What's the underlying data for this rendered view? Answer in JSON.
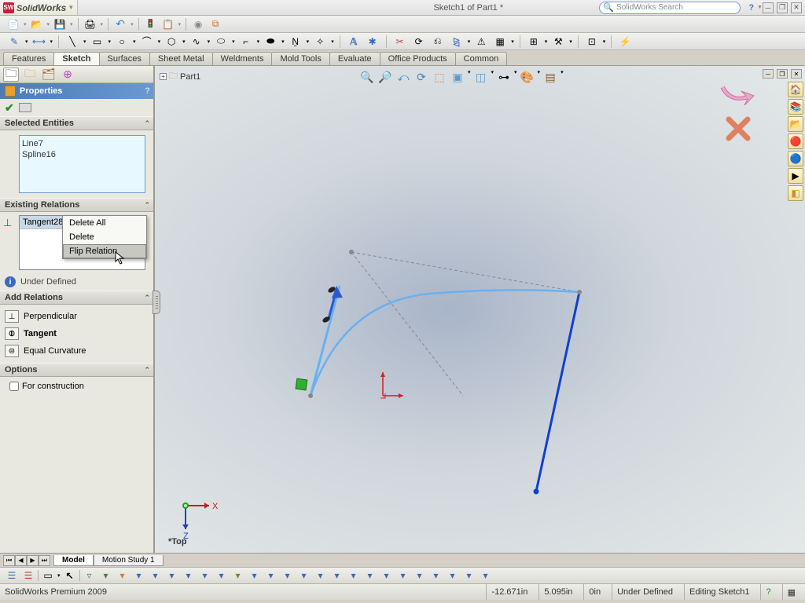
{
  "app": {
    "name": "SolidWorks",
    "short": "SW"
  },
  "title": "Sketch1 of Part1 *",
  "search_placeholder": "SolidWorks Search",
  "cmdtabs": {
    "t0": "Features",
    "t1": "Sketch",
    "t2": "Surfaces",
    "t3": "Sheet Metal",
    "t4": "Weldments",
    "t5": "Mold Tools",
    "t6": "Evaluate",
    "t7": "Office Products",
    "t8": "Common"
  },
  "tree_root": "Part1",
  "props": {
    "title": "Properties"
  },
  "sections": {
    "selected": "Selected Entities",
    "existing": "Existing Relations",
    "add": "Add Relations",
    "options": "Options"
  },
  "selected_items": {
    "a": "Line7",
    "b": "Spline16"
  },
  "existing_rel": "Tangent28",
  "ctx": {
    "a": "Delete All",
    "b": "Delete",
    "c": "Flip Relation"
  },
  "status_def": "Under Defined",
  "add_rel": {
    "a": "Perpendicular",
    "b": "Tangent",
    "c": "Equal Curvature"
  },
  "options": {
    "construction": "For construction"
  },
  "view_label": "*Top",
  "bottom_tabs": {
    "a": "Model",
    "b": "Motion Study 1"
  },
  "statusbar": {
    "product": "SolidWorks Premium 2009",
    "x": "-12.671in",
    "y": "5.095in",
    "z": "0in",
    "def": "Under Defined",
    "mode": "Editing Sketch1"
  }
}
